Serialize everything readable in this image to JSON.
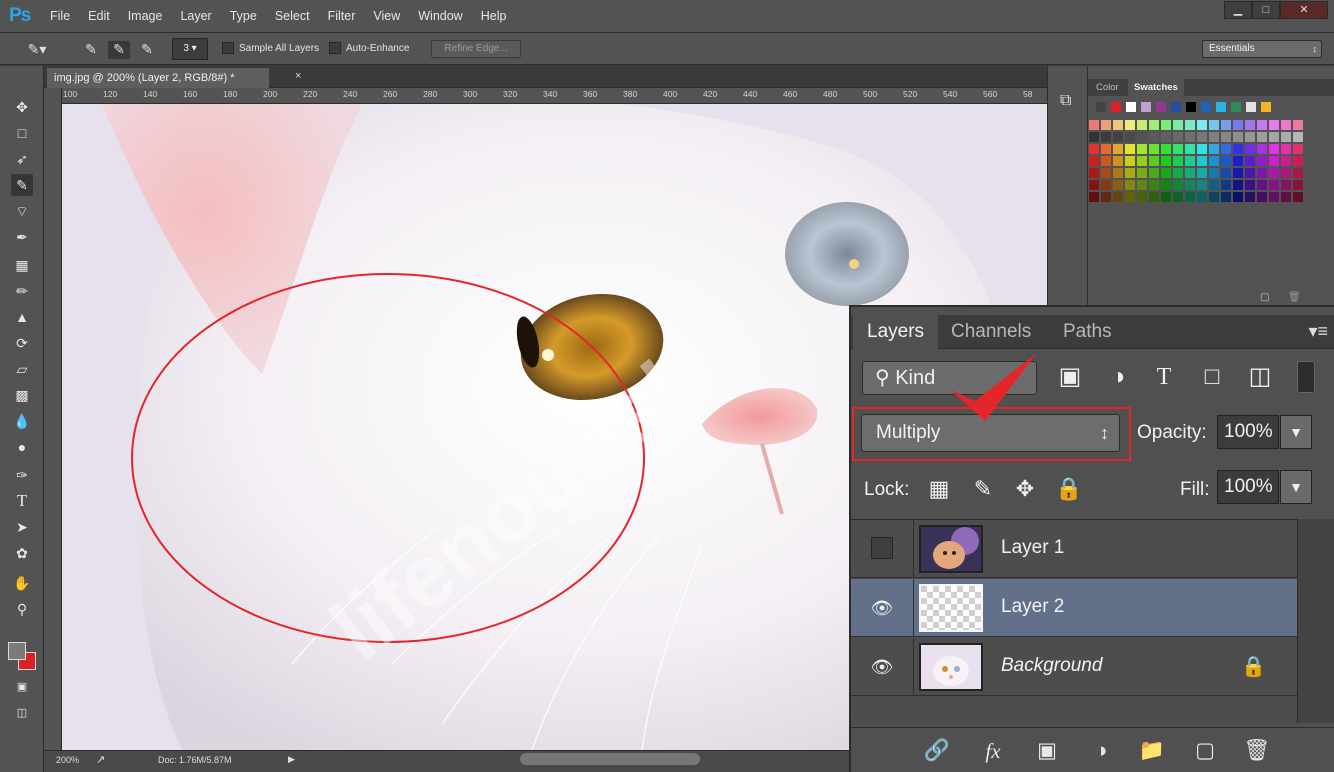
{
  "app": {
    "logo": "Ps",
    "menus": [
      "File",
      "Edit",
      "Image",
      "Layer",
      "Type",
      "Select",
      "Filter",
      "View",
      "Window",
      "Help"
    ],
    "window_buttons": {
      "minimize": "▁",
      "maximize": "□",
      "close": "✕"
    }
  },
  "options_bar": {
    "brush_size": "3",
    "sample_all_layers": "Sample All Layers",
    "auto_enhance": "Auto-Enhance",
    "refine_edge": "Refine Edge...",
    "workspace": "Essentials"
  },
  "document": {
    "tab_title": "img.jpg @ 200% (Layer 2, RGB/8#) *",
    "close_glyph": "×",
    "ruler_ticks": [
      "100",
      "120",
      "140",
      "160",
      "180",
      "200",
      "220",
      "240",
      "260",
      "280",
      "300",
      "320",
      "340",
      "360",
      "380",
      "400",
      "420",
      "440",
      "460",
      "480",
      "500",
      "520",
      "540",
      "560",
      "58"
    ],
    "zoom": "200%",
    "doc_size": "Doc: 1.76M/5.87M",
    "watermark": "lifenourish"
  },
  "swatches_panel": {
    "tabs": [
      "Color",
      "Swatches"
    ],
    "active_tab": "Swatches"
  },
  "layers_panel": {
    "tabs": [
      "Layers",
      "Channels",
      "Paths"
    ],
    "active_tab": "Layers",
    "filter_kind": "Kind",
    "blend_mode": "Multiply",
    "opacity_label": "Opacity:",
    "opacity_value": "100%",
    "lock_label": "Lock:",
    "fill_label": "Fill:",
    "fill_value": "100%",
    "layers": [
      {
        "name": "Layer 1",
        "visible": false,
        "selected": false,
        "locked": false
      },
      {
        "name": "Layer 2",
        "visible": true,
        "selected": true,
        "locked": false
      },
      {
        "name": "Background",
        "visible": true,
        "selected": false,
        "locked": true
      }
    ],
    "footer_icons": [
      "link-icon",
      "fx-icon",
      "mask-icon",
      "adjustment-icon",
      "folder-icon",
      "new-layer-icon",
      "trash-icon"
    ]
  },
  "colors": {
    "accent_red": "#e4262b",
    "selected_layer": "#62708a",
    "panel_bg": "#535353"
  }
}
